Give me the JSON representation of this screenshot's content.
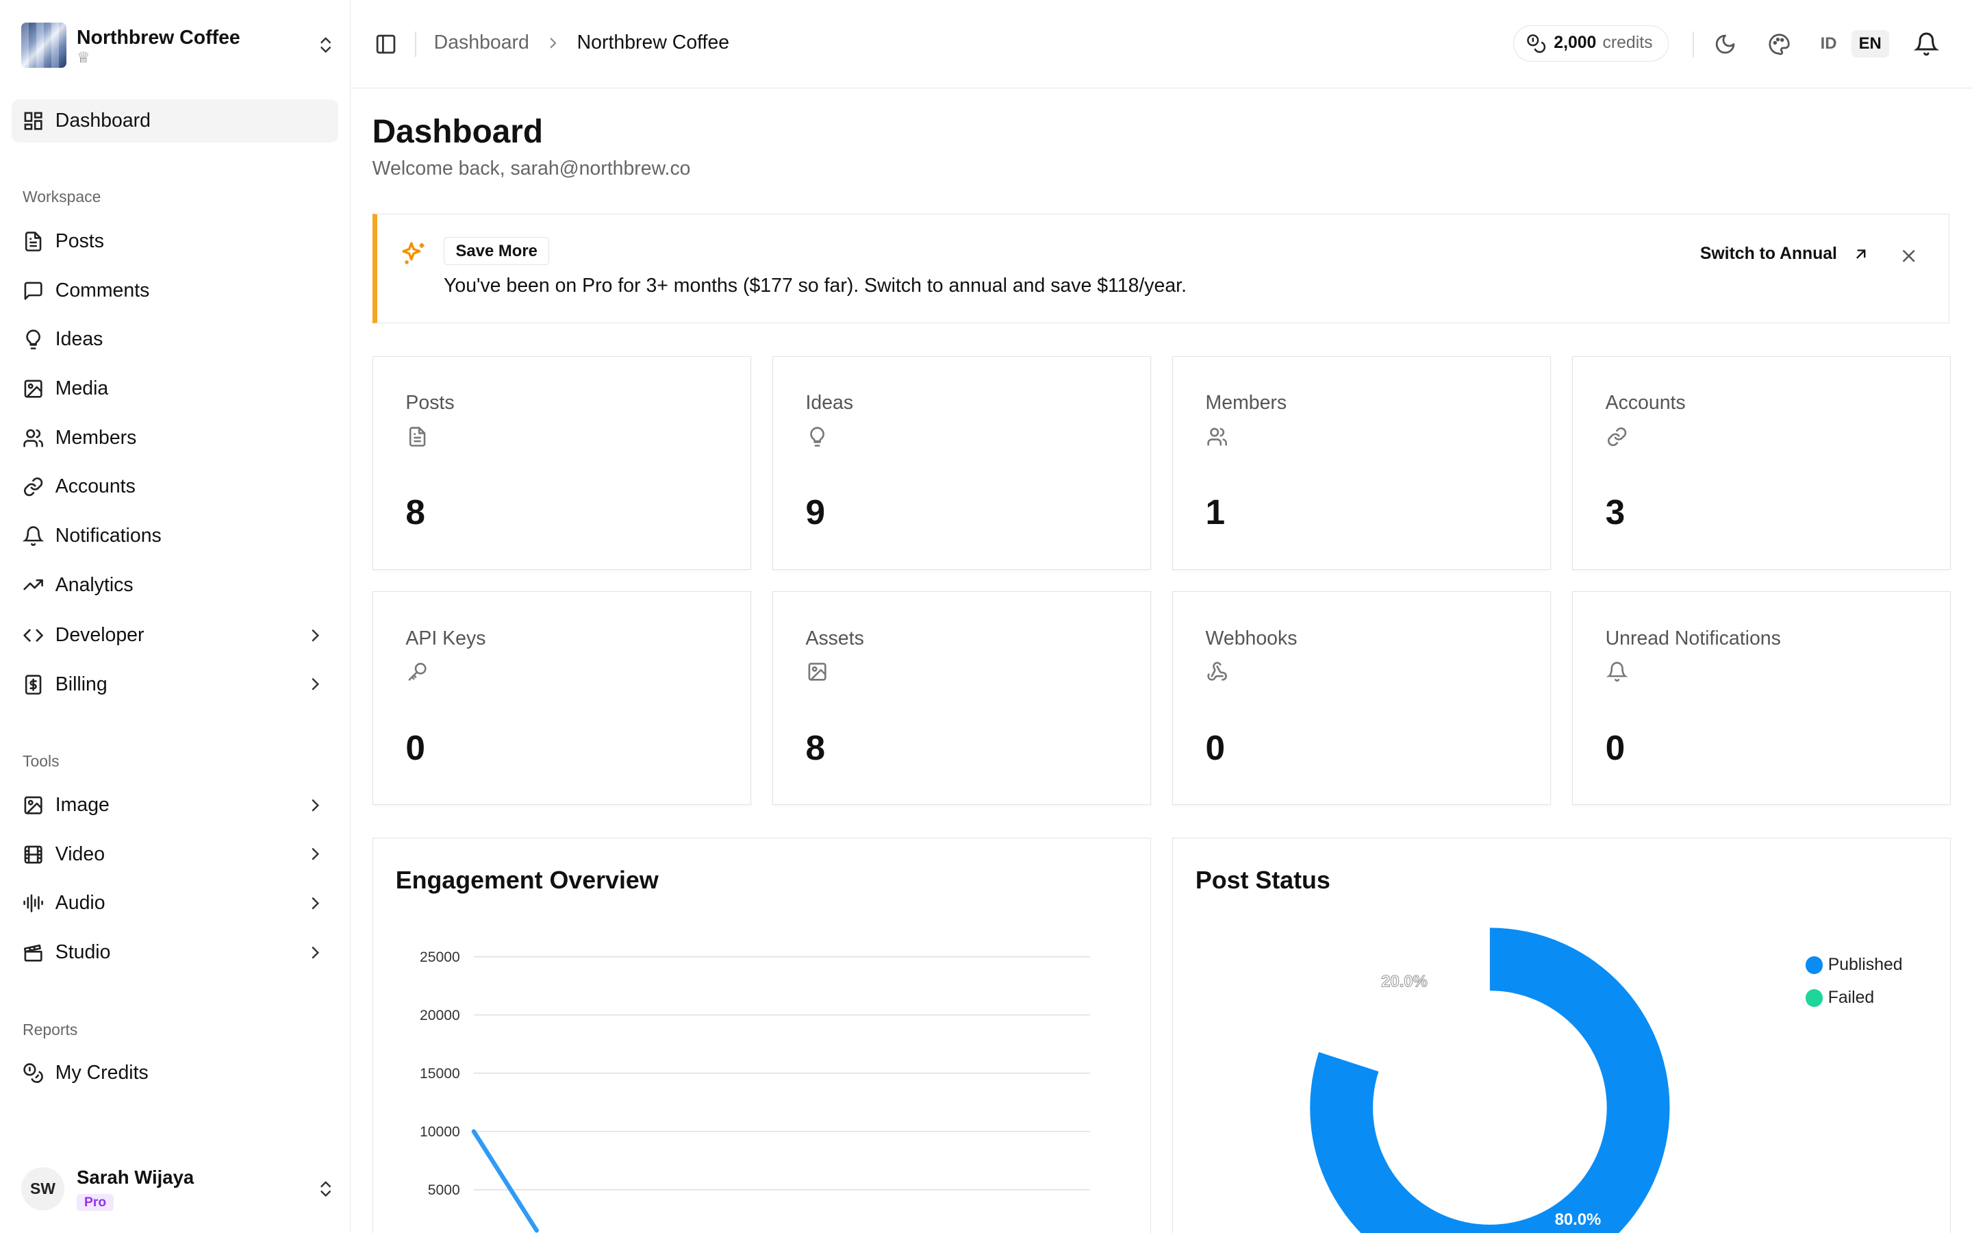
{
  "workspace": {
    "name": "Northbrew Coffee"
  },
  "nav": {
    "dashboard": "Dashboard",
    "workspace_label": "Workspace",
    "workspace_items": [
      "Posts",
      "Comments",
      "Ideas",
      "Media",
      "Members",
      "Accounts",
      "Notifications",
      "Analytics",
      "Developer",
      "Billing"
    ],
    "tools_label": "Tools",
    "tools_items": [
      "Image",
      "Video",
      "Audio",
      "Studio"
    ],
    "reports_label": "Reports",
    "reports_items": [
      "My Credits"
    ]
  },
  "user": {
    "initials": "SW",
    "name": "Sarah Wijaya",
    "plan": "Pro"
  },
  "topbar": {
    "breadcrumb": [
      "Dashboard",
      "Northbrew Coffee"
    ],
    "credits_value": "2,000",
    "credits_label": "credits",
    "lang_options": [
      "ID",
      "EN"
    ],
    "lang_selected": "EN"
  },
  "page": {
    "title": "Dashboard",
    "subtitle": "Welcome back, sarah@northbrew.co"
  },
  "banner": {
    "tag": "Save More",
    "text": "You've been on Pro for 3+ months ($177 so far). Switch to annual and save $118/year.",
    "cta": "Switch to Annual",
    "accent": "#f5a623"
  },
  "stats": [
    {
      "label": "Posts",
      "value": "8",
      "icon": "file-text-icon"
    },
    {
      "label": "Ideas",
      "value": "9",
      "icon": "lightbulb-icon"
    },
    {
      "label": "Members",
      "value": "1",
      "icon": "users-icon"
    },
    {
      "label": "Accounts",
      "value": "3",
      "icon": "link-icon"
    },
    {
      "label": "API Keys",
      "value": "0",
      "icon": "key-icon"
    },
    {
      "label": "Assets",
      "value": "8",
      "icon": "image-icon"
    },
    {
      "label": "Webhooks",
      "value": "0",
      "icon": "webhook-icon"
    },
    {
      "label": "Unread Notifications",
      "value": "0",
      "icon": "bell-icon"
    }
  ],
  "chart_data": [
    {
      "type": "line",
      "title": "Engagement Overview",
      "y_ticks": [
        25000,
        20000,
        15000,
        10000,
        5000
      ],
      "ylim": [
        0,
        27500
      ],
      "grid": true,
      "series": [
        {
          "color": "#2f9bf5",
          "points": [
            {
              "x": 0,
              "y": 10000
            },
            {
              "x": 1,
              "y": 1500
            }
          ]
        }
      ]
    },
    {
      "type": "pie",
      "title": "Post Status",
      "donut": true,
      "legend_position": "top-right",
      "slices": [
        {
          "label": "Published",
          "value": 80.0,
          "display": "80.0%",
          "color": "#0a8cf5"
        },
        {
          "label": "Failed",
          "value": 20.0,
          "display": "20.0%",
          "color": "#1dd69a"
        }
      ]
    }
  ]
}
